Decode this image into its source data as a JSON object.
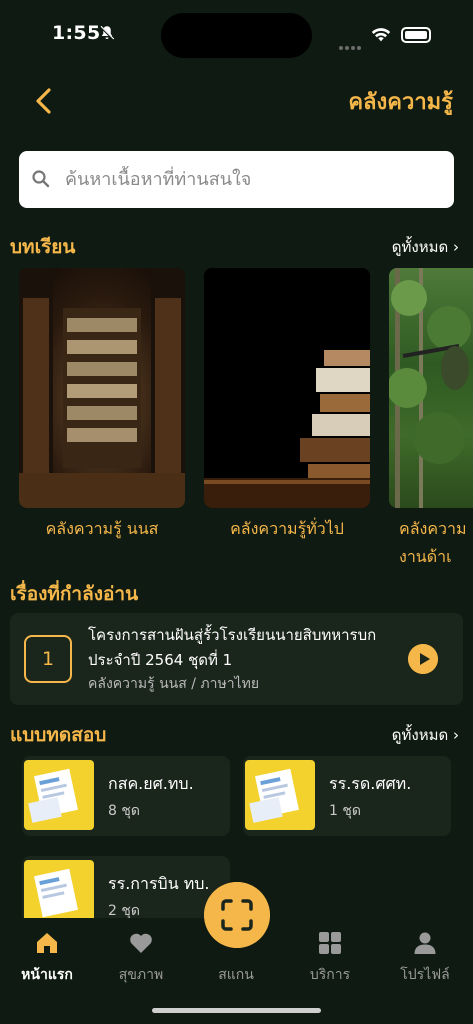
{
  "status_bar": {
    "time": "1:55"
  },
  "header": {
    "title": "คลังความรู้"
  },
  "search": {
    "placeholder": "ค้นหาเนื้อหาที่ท่านสนใจ"
  },
  "lessons": {
    "title": "บทเรียน",
    "see_all": "ดูทั้งหมด",
    "items": [
      {
        "label": "คลังความรู้ นนส"
      },
      {
        "label": "คลังความรู้ทั่วไป"
      },
      {
        "label": "คลังความ\nงานด้าเ"
      }
    ]
  },
  "reading": {
    "title": "เรื่องที่กำลังอ่าน",
    "number": "1",
    "item_title": "โครงการสานฝันสู่รั้วโรงเรียนนายสิบทหารบก ประจำปี 2564 ชุดที่ 1",
    "item_sub": "คลังความรู้ นนส / ภาษาไทย"
  },
  "tests": {
    "title": "แบบทดสอบ",
    "see_all": "ดูทั้งหมด",
    "items": [
      {
        "name": "กสค.ยศ.ทบ.",
        "count": "8 ชุด"
      },
      {
        "name": "รร.รด.ศศท.",
        "count": "1 ชุด"
      },
      {
        "name": "รร.การบิน ทบ.",
        "count": "2 ชุด"
      }
    ]
  },
  "bottom_nav": {
    "items": [
      {
        "label": "หน้าแรก",
        "icon": "home-icon"
      },
      {
        "label": "สุขภาพ",
        "icon": "heart-icon"
      },
      {
        "label": "สแกน",
        "icon": "scan-icon"
      },
      {
        "label": "บริการ",
        "icon": "grid-icon"
      },
      {
        "label": "โปรไฟล์",
        "icon": "user-icon"
      }
    ]
  },
  "colors": {
    "accent": "#f5b74a",
    "background": "#0f1a12",
    "card": "#1a251c"
  }
}
